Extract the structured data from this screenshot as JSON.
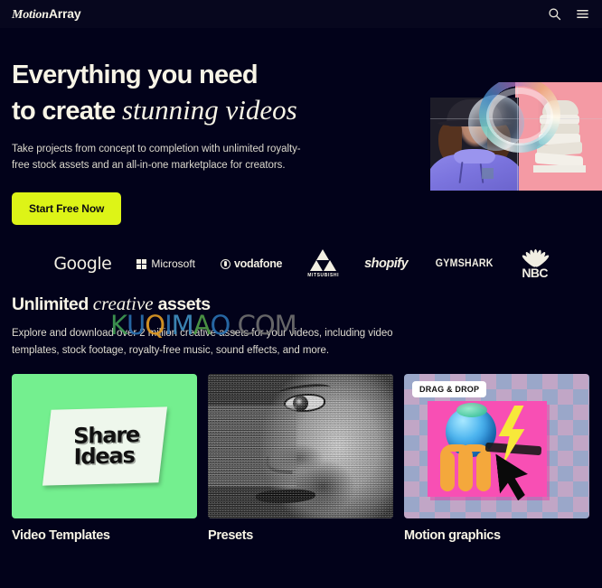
{
  "site": {
    "brand_part1": "Motion",
    "brand_part2": "Array",
    "background_color": "#02021a",
    "accent_color": "#ddf417",
    "text_color": "#f7f4e6"
  },
  "header": {
    "search_icon": "search-icon",
    "menu_icon": "hamburger-menu-icon"
  },
  "hero": {
    "heading_line1": "Everything you need",
    "heading_line2_plain": "to create ",
    "heading_line2_italic": "stunning videos",
    "subtext": "Take projects from concept to completion with unlimited royalty-free stock assets and an all-in-one marketplace for creators.",
    "cta_label": "Start Free Now"
  },
  "logos": {
    "items": [
      {
        "name": "google",
        "label": "Google"
      },
      {
        "name": "microsoft",
        "label": "Microsoft"
      },
      {
        "name": "vodafone",
        "label": "vodafone"
      },
      {
        "name": "mitsubishi",
        "label": "MITSUBISHI"
      },
      {
        "name": "shopify",
        "label": "shopify"
      },
      {
        "name": "gymshark",
        "label": "GYMSHARK"
      },
      {
        "name": "nbc",
        "label": "NBC"
      }
    ]
  },
  "assets": {
    "heading_plain1": "Unlimited ",
    "heading_italic": "creative",
    "heading_plain2": " assets",
    "subtext": "Explore and download over 2 million creative assets for your videos, including video templates, stock footage, royalty-free music, sound effects, and more."
  },
  "watermark": {
    "letters": [
      {
        "char": "K",
        "color": "#3f9a52"
      },
      {
        "char": "U",
        "color": "#2a6fae"
      },
      {
        "char": "Q",
        "color": "#e09a24"
      },
      {
        "char": "I",
        "color": "#2a6fae"
      },
      {
        "char": "M",
        "color": "#3f8fbe"
      },
      {
        "char": "A",
        "color": "#4e9c46"
      },
      {
        "char": "O",
        "color": "#2a6fae"
      },
      {
        "char": ".",
        "color": "#7d7d7d"
      },
      {
        "char": "C",
        "color": "#6e6e6e"
      },
      {
        "char": "O",
        "color": "#6e6e6e"
      },
      {
        "char": "M",
        "color": "#6e6e6e"
      }
    ]
  },
  "cards": [
    {
      "title": "Video Templates",
      "thumb_text_line1": "Share",
      "thumb_text_line2": "Ideas",
      "bg_color": "#74ef8f"
    },
    {
      "title": "Presets",
      "bg_color": "#8c8c8c"
    },
    {
      "title": "Motion graphics",
      "badge": "DRAG & DROP",
      "bg_color": "#c8a8c4"
    }
  ]
}
